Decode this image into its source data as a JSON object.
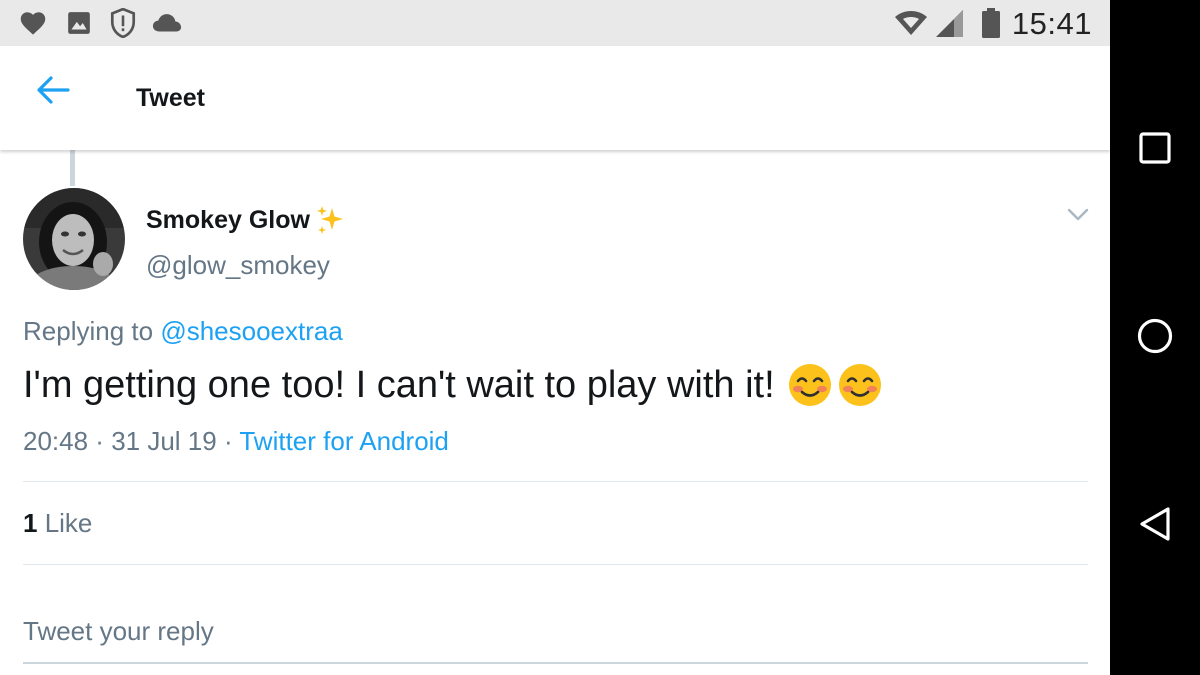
{
  "status_bar": {
    "time": "15:41",
    "left_icons": [
      "heart-icon",
      "image-icon",
      "shield-alert-icon",
      "cloud-icon"
    ],
    "right_icons": [
      "wifi-icon",
      "signal-icon",
      "battery-icon"
    ]
  },
  "header": {
    "title": "Tweet",
    "back_icon": "arrow-left-icon",
    "accent": "#1da1f2"
  },
  "tweet": {
    "display_name": "Smokey Glow",
    "name_emoji": "sparkles-icon",
    "handle": "@glow_smokey",
    "replying_prefix": "Replying to ",
    "replying_to": "@shesooextraa",
    "text": "I'm getting one too! I can't wait to play with it!",
    "text_emojis": [
      "smiling-face-icon",
      "smiling-face-icon"
    ],
    "time": "20:48",
    "sep1": " · ",
    "date": "31 Jul 19",
    "sep2": " · ",
    "source": "Twitter for Android"
  },
  "stats": {
    "like_count": "1",
    "like_label": " Like"
  },
  "reply": {
    "placeholder": "Tweet your reply"
  },
  "nav_bar": {
    "buttons": [
      "recents-square-icon",
      "home-circle-icon",
      "back-triangle-icon"
    ]
  }
}
